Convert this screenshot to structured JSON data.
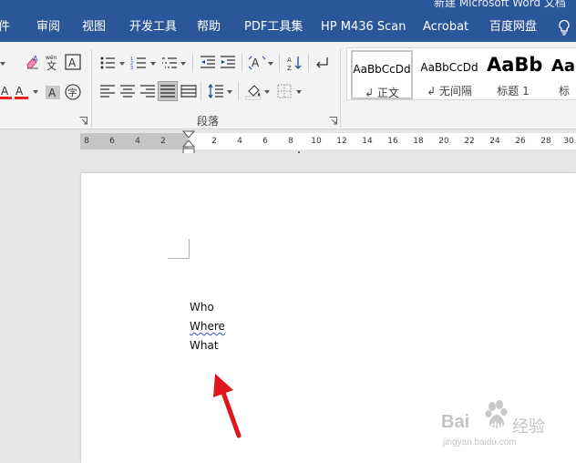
{
  "window": {
    "title_fragment": "新建 Microsoft Word 文档"
  },
  "tabs": [
    {
      "label": "件"
    },
    {
      "label": "审阅"
    },
    {
      "label": "视图"
    },
    {
      "label": "开发工具"
    },
    {
      "label": "帮助"
    },
    {
      "label": "PDF工具集"
    },
    {
      "label": "HP M436 Scan"
    },
    {
      "label": "Acrobat"
    },
    {
      "label": "百度网盘"
    }
  ],
  "icons": {
    "tell_me": "lightbulb-icon",
    "font_row1": [
      "clear-formatting-icon",
      "phonetic-guide-icon",
      "character-border-icon"
    ],
    "font_row2": [
      "font-color-icon",
      "character-shading-icon",
      "enclosed-character-icon"
    ],
    "paragraph_row1": [
      "bullets-icon",
      "numbering-icon",
      "multilevel-list-icon",
      "decrease-indent-icon",
      "increase-indent-icon",
      "chinese-layout-icon",
      "sort-icon",
      "show-marks-icon"
    ],
    "paragraph_row2": [
      "align-left-icon",
      "center-icon",
      "align-right-icon",
      "justify-icon",
      "distributed-icon",
      "line-spacing-icon",
      "shading-icon",
      "borders-icon"
    ]
  },
  "ribbon": {
    "paragraph_group_label": "段落",
    "font_color": "#e8231d"
  },
  "styles": [
    {
      "preview": "AaBbCcDd",
      "name": "↲ 正文"
    },
    {
      "preview": "AaBbCcDd",
      "name": "↲ 无间隔"
    },
    {
      "preview": "AaBb",
      "name": "标题 1"
    },
    {
      "preview": "AaI",
      "name": "标"
    }
  ],
  "ruler": {
    "left_numbers": [
      "8",
      "6",
      "4",
      "2"
    ],
    "right_numbers": [
      "2",
      "4",
      "6",
      "8",
      "10",
      "12",
      "14",
      "16",
      "18",
      "20",
      "22",
      "24",
      "26",
      "28",
      "30"
    ]
  },
  "document": {
    "lines": [
      "Who",
      "Where",
      "What"
    ],
    "spellcheck_flagged_line": "Where"
  },
  "annotation": {
    "arrow_color": "#e0151f"
  },
  "watermark": {
    "brand": "Bai",
    "brand_suffix": "du",
    "cn": "经验",
    "url": "jingyan.baidu.com"
  },
  "colors": {
    "ribbon_tab_bar": "#2b579a",
    "ribbon_body": "#f3f3f3",
    "page": "#ffffff",
    "canvas": "#e6e6e6"
  }
}
